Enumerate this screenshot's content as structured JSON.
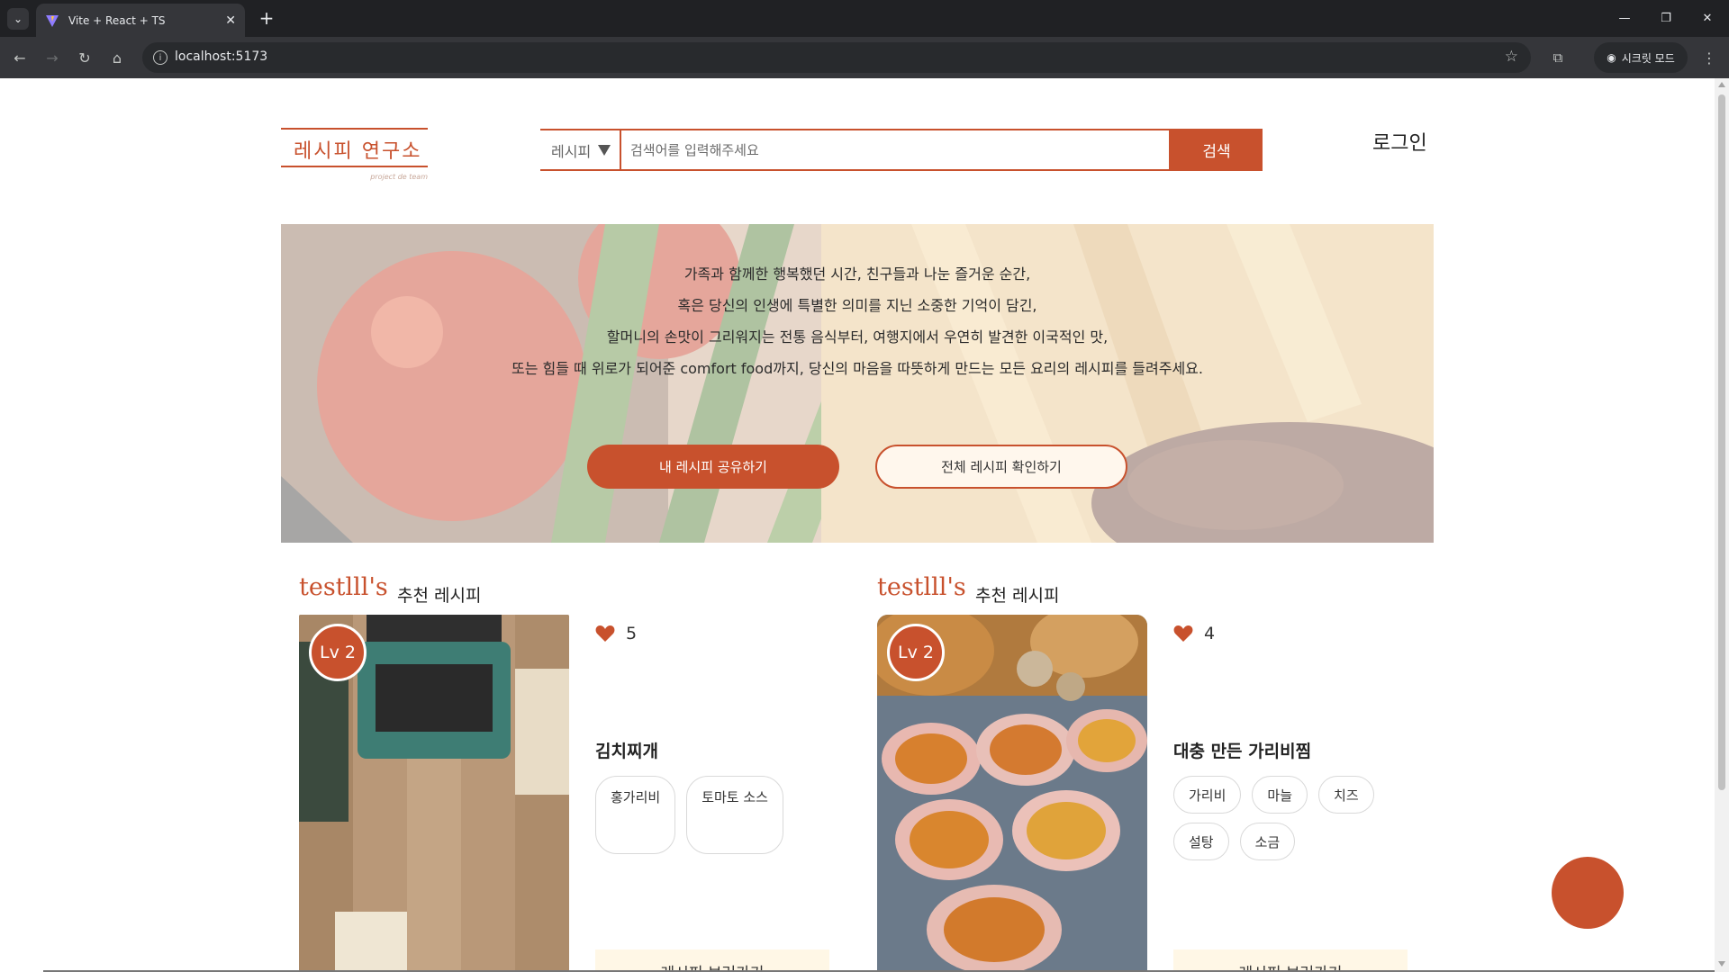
{
  "browser": {
    "tab_title": "Vite + React + TS",
    "url": "localhost:5173",
    "incognito_label": "시크릿 모드",
    "icons": [
      "tab-list-icon",
      "vite-favicon-icon",
      "close-icon",
      "plus-icon",
      "minimize-icon",
      "restore-icon",
      "back-icon",
      "forward-icon",
      "reload-icon",
      "home-icon",
      "info-icon",
      "star-icon",
      "extensions-icon",
      "incognito-icon",
      "more-icon"
    ]
  },
  "header": {
    "logo_text": "레시피 연구소",
    "logo_tagline": "project de team",
    "search_category": "레시피",
    "search_placeholder": "검색어를 입력해주세요",
    "search_button": "검색",
    "login": "로그인"
  },
  "hero": {
    "lines": [
      "가족과 함께한 행복했던 시간, 친구들과 나눈 즐거운 순간,",
      "혹은 당신의 인생에 특별한 의미를 지닌 소중한 기억이 담긴,",
      "할머니의 손맛이 그리워지는 전통 음식부터, 여행지에서 우연히 발견한 이국적인 맛,",
      "또는 힘들 때 위로가 되어준 comfort food까지, 당신의 마음을 따뜻하게 만드는 모든 요리의 레시피를 들려주세요."
    ],
    "primary_button": "내 레시피 공유하기",
    "secondary_button": "전체 레시피 확인하기"
  },
  "recommendations": [
    {
      "user": "testlll's",
      "heading": "추천 레시피",
      "level": "Lv 2",
      "likes": "5",
      "title": "김치찌개",
      "tags": [
        "홍가리비",
        "토마토 소스"
      ],
      "more": "레시피 보러가기"
    },
    {
      "user": "testlll's",
      "heading": "추천 레시피",
      "level": "Lv 2",
      "likes": "4",
      "title": "대충 만든 가리비찜",
      "tags": [
        "가리비",
        "마늘",
        "치즈",
        "설탕",
        "소금"
      ],
      "more": "레시피 보러가기"
    }
  ],
  "colors": {
    "accent": "#c8512d",
    "cream": "#fff7e6"
  }
}
